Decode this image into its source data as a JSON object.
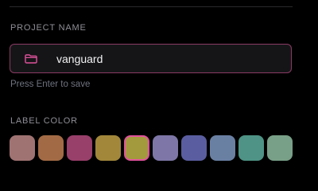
{
  "project_name": {
    "section_title": "PROJECT NAME",
    "value": "vanguard",
    "hint": "Press Enter to save",
    "icon": "folder-icon",
    "accent": "#e0529c"
  },
  "label_color": {
    "section_title": "LABEL COLOR",
    "selected_index": 4,
    "swatches": [
      {
        "color": "#a07373"
      },
      {
        "color": "#a26b45"
      },
      {
        "color": "#983f6a"
      },
      {
        "color": "#a2873b"
      },
      {
        "color": "#a39a3e"
      },
      {
        "color": "#7d76a6"
      },
      {
        "color": "#5a5d9f"
      },
      {
        "color": "#6a80a3"
      },
      {
        "color": "#4e9385"
      },
      {
        "color": "#78a088"
      }
    ]
  }
}
